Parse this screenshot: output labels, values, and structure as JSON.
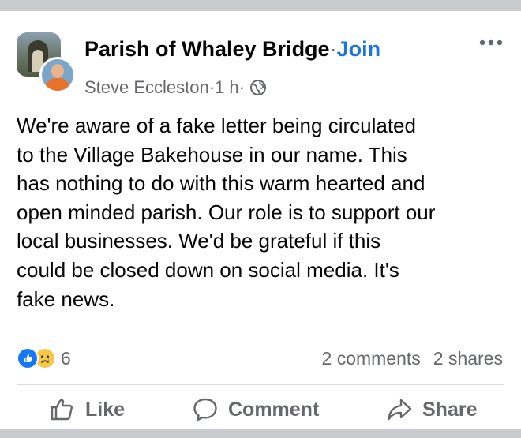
{
  "post": {
    "group_name": "Parish of Whaley Bridge",
    "separator": " · ",
    "join_label": "Join",
    "author": "Steve Eccleston",
    "meta_sep": " · ",
    "time": "1 h",
    "audience_icon": "globe-icon",
    "more_icon": "more-horizontal-icon",
    "text": "We're aware of a fake letter being circulated\nto the Village Bakehouse in our name. This\nhas nothing to do with this warm hearted and\nopen minded parish. Our role is to support our\nlocal businesses. We'd be grateful if this\ncould be closed down on social media. It's\nfake news."
  },
  "reactions": {
    "icons": [
      "like-reaction-icon",
      "sad-reaction-icon"
    ],
    "count": "6",
    "comments": "2 comments",
    "shares": "2 shares"
  },
  "actions": {
    "like_label": "Like",
    "comment_label": "Comment",
    "share_label": "Share"
  },
  "colors": {
    "accent": "#1b74e4",
    "text": "#050505",
    "secondary": "#65676b",
    "background": "#c9cbce",
    "card": "#ffffff"
  }
}
